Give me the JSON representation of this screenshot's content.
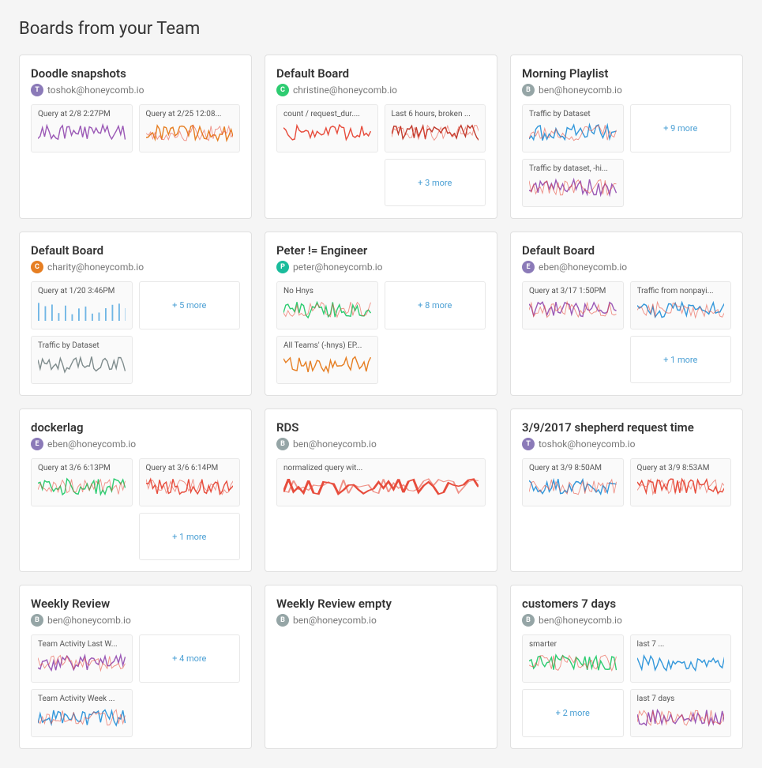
{
  "page": {
    "title": "Boards from your Team"
  },
  "boards": [
    {
      "id": "doodle-snapshots",
      "name": "Doodle snapshots",
      "owner": "toshok@honeycomb.io",
      "avatar_color": "#8b7ab8",
      "avatar_letter": "t",
      "tiles": [
        {
          "label": "Query at 2/8 2:27PM",
          "type": "chart",
          "color": "#9b59b6"
        },
        {
          "label": "Query at 2/25 12:08...",
          "type": "chart",
          "color": "#e67e22"
        }
      ],
      "more": null
    },
    {
      "id": "default-board-1",
      "name": "Default Board",
      "owner": "christine@honeycomb.io",
      "avatar_color": "#2ecc71",
      "avatar_letter": "c",
      "tiles": [
        {
          "label": "count / request_dur....",
          "type": "chart",
          "color": "#e74c3c"
        },
        {
          "label": "Last 6 hours, broken ...",
          "type": "chart",
          "color": "#c0392b"
        }
      ],
      "more": "+ 3 more"
    },
    {
      "id": "morning-playlist",
      "name": "Morning Playlist",
      "owner": "ben@honeycomb.io",
      "avatar_color": "#95a5a6",
      "avatar_letter": "b",
      "tiles": [
        {
          "label": "Traffic by Dataset",
          "type": "chart",
          "color": "#3498db"
        },
        {
          "label": "+ 9 more",
          "type": "more"
        },
        {
          "label": "Traffic by dataset, -hi...",
          "type": "chart",
          "color": "#9b59b6"
        }
      ],
      "more": null
    },
    {
      "id": "default-board-2",
      "name": "Default Board",
      "owner": "charity@honeycomb.io",
      "avatar_color": "#e67e22",
      "avatar_letter": "c",
      "tiles": [
        {
          "label": "Query at 1/20 3:46PM",
          "type": "chart",
          "color": "#3498db"
        },
        {
          "label": "+ 5 more",
          "type": "more"
        },
        {
          "label": "Traffic by Dataset",
          "type": "chart",
          "color": "#7f8c8d"
        }
      ],
      "more": null
    },
    {
      "id": "peter-engineer",
      "name": "Peter != Engineer",
      "owner": "peter@honeycomb.io",
      "avatar_color": "#1abc9c",
      "avatar_letter": "p",
      "tiles": [
        {
          "label": "No Hnys",
          "type": "chart",
          "color": "#2ecc71"
        },
        {
          "label": "+ 8 more",
          "type": "more"
        },
        {
          "label": "All Teams' (-hnys) EP...",
          "type": "chart",
          "color": "#e67e22"
        }
      ],
      "more": null
    },
    {
      "id": "default-board-3",
      "name": "Default Board",
      "owner": "eben@honeycomb.io",
      "avatar_color": "#8b7ab8",
      "avatar_letter": "e",
      "tiles": [
        {
          "label": "Query at 3/17 1:50PM",
          "type": "chart",
          "color": "#9b59b6"
        },
        {
          "label": "Traffic from nonpayi...",
          "type": "chart",
          "color": "#3498db"
        }
      ],
      "more": "+ 1 more"
    },
    {
      "id": "dockerlag",
      "name": "dockerlag",
      "owner": "eben@honeycomb.io",
      "avatar_color": "#8b7ab8",
      "avatar_letter": "e",
      "tiles": [
        {
          "label": "Query at 3/6 6:13PM",
          "type": "chart",
          "color": "#2ecc71"
        },
        {
          "label": "Query at 3/6 6:14PM",
          "type": "chart",
          "color": "#e74c3c"
        }
      ],
      "more": "+ 1 more"
    },
    {
      "id": "rds",
      "name": "RDS",
      "owner": "ben@honeycomb.io",
      "avatar_color": "#95a5a6",
      "avatar_letter": "b",
      "tiles": [
        {
          "label": "normalized query wit...",
          "type": "chart",
          "color": "#e74c3c"
        }
      ],
      "more": null
    },
    {
      "id": "shepherd-request-time",
      "name": "3/9/2017 shepherd request time",
      "owner": "toshok@honeycomb.io",
      "avatar_color": "#8b7ab8",
      "avatar_letter": "t",
      "tiles": [
        {
          "label": "Query at 3/9 8:50AM",
          "type": "chart",
          "color": "#3498db"
        },
        {
          "label": "Query at 3/9 8:53AM",
          "type": "chart",
          "color": "#e74c3c"
        }
      ],
      "more": null
    },
    {
      "id": "weekly-review",
      "name": "Weekly Review",
      "owner": "ben@honeycomb.io",
      "avatar_color": "#95a5a6",
      "avatar_letter": "b",
      "tiles": [
        {
          "label": "Team Activity Last W...",
          "type": "chart",
          "color": "#9b59b6"
        },
        {
          "label": "+ 4 more",
          "type": "more"
        },
        {
          "label": "Team Activity Week ...",
          "type": "chart",
          "color": "#3498db"
        }
      ],
      "more": null
    },
    {
      "id": "weekly-review-empty",
      "name": "Weekly Review empty",
      "owner": "ben@honeycomb.io",
      "avatar_color": "#95a5a6",
      "avatar_letter": "b",
      "tiles": [],
      "more": null
    },
    {
      "id": "customers-7-days",
      "name": "customers 7 days",
      "owner": "ben@honeycomb.io",
      "avatar_color": "#95a5a6",
      "avatar_letter": "b",
      "tiles": [
        {
          "label": "smarter",
          "type": "chart",
          "color": "#2ecc71"
        },
        {
          "label": "last 7 ...",
          "type": "chart",
          "color": "#3498db"
        },
        {
          "label": "+ 2 more",
          "type": "more"
        },
        {
          "label": "last 7 days",
          "type": "chart",
          "color": "#9b59b6"
        }
      ],
      "more": null
    }
  ]
}
